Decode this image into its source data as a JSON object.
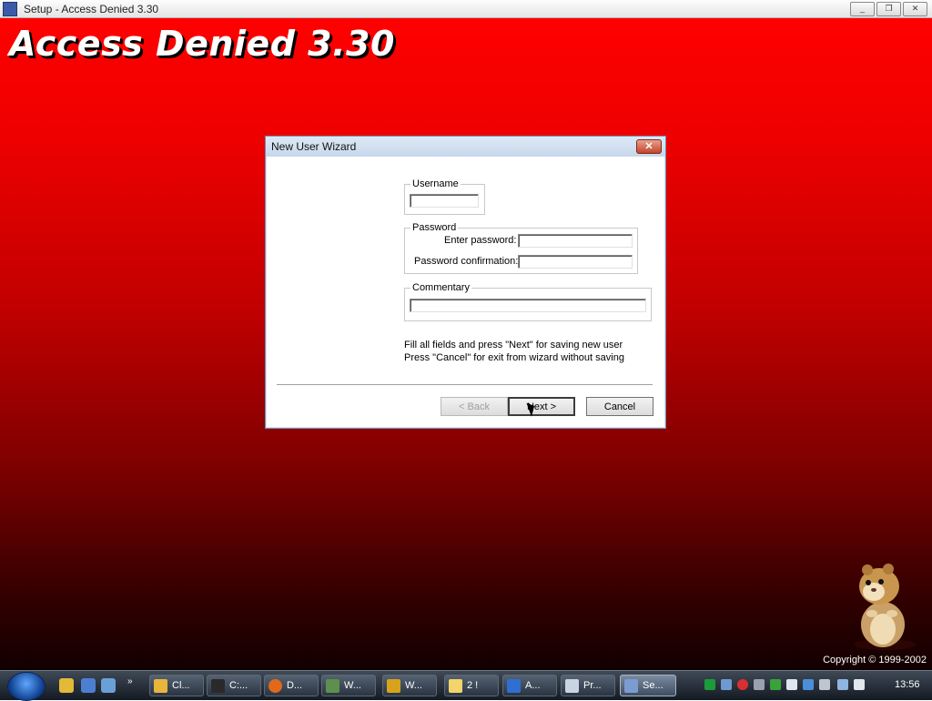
{
  "window": {
    "title": "Setup - Access Denied 3.30",
    "minimize_label": "_",
    "restore_label": "❐",
    "close_label": "✕"
  },
  "app": {
    "heading": "Access Denied 3.30",
    "copyright": "Copyright © 1999-2002"
  },
  "dialog": {
    "title": "New User Wizard",
    "close_label": "✕",
    "username_group": "Username",
    "username_value": "",
    "password_group": "Password",
    "enter_password_label": "Enter password:",
    "enter_password_value": "",
    "confirm_password_label": "Password confirmation:",
    "confirm_password_value": "",
    "commentary_group": "Commentary",
    "commentary_value": "",
    "info_line1": "Fill  all fields and press \"Next\" for saving new user",
    "info_line2": "Press \"Cancel\" for exit from wizard without saving",
    "back_label": "< Back",
    "next_label": "Next >",
    "cancel_label": "Cancel"
  },
  "taskbar": {
    "items": [
      {
        "label": "Cl...",
        "color": "#e8b63a"
      },
      {
        "label": "C:...",
        "color": "#2a2a2a"
      },
      {
        "label": "D...",
        "color": "#e06a1a"
      },
      {
        "label": "W...",
        "color": "#5e8f4c"
      },
      {
        "label": "W...",
        "color": "#d8a21c"
      },
      {
        "label": "2 !",
        "color": "#f2d46a"
      },
      {
        "label": "A...",
        "color": "#2f6fd1"
      },
      {
        "label": "Pr...",
        "color": "#c9d4e2"
      },
      {
        "label": "Se...",
        "color": "#7c9bd1"
      }
    ],
    "clock": "13:56"
  }
}
